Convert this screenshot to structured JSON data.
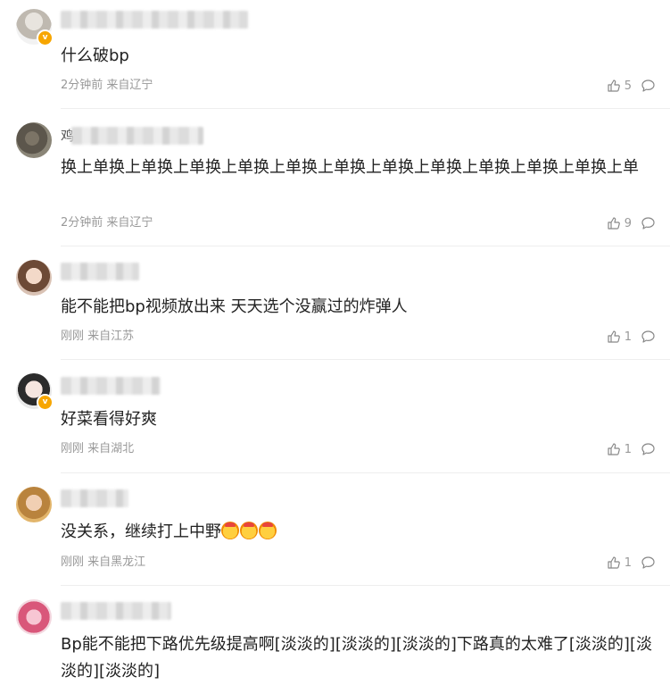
{
  "comments": [
    {
      "name_initial": "",
      "text": "什么破bp",
      "time": "2分钟前",
      "location": "来自辽宁",
      "likes": "5",
      "verified": true
    },
    {
      "name_initial": "鸡",
      "text": "换上单换上单换上单换上单换上单换上单换上单换上单换上单换上单换上单换上单",
      "time": "2分钟前",
      "location": "来自辽宁",
      "likes": "9",
      "verified": false
    },
    {
      "name_initial": "",
      "text": "能不能把bp视频放出来 天天选个没赢过的炸弹人",
      "time": "刚刚",
      "location": "来自江苏",
      "likes": "1",
      "verified": false
    },
    {
      "name_initial": "",
      "text": "好菜看得好爽",
      "time": "刚刚",
      "location": "来自湖北",
      "likes": "1",
      "verified": true
    },
    {
      "name_initial": "",
      "text": "没关系，继续打上中野",
      "time": "刚刚",
      "location": "来自黑龙江",
      "likes": "1",
      "verified": false
    },
    {
      "name_initial": "",
      "text": "Bp能不能把下路优先级提高啊[淡淡的][淡淡的][淡淡的]下路真的太难了[淡淡的][淡淡的][淡淡的]",
      "time": "",
      "location": "",
      "likes": "",
      "verified": false
    }
  ],
  "icons": {
    "like": "thumbs-up-icon",
    "reply": "comment-bubble-icon",
    "verified": "verified-badge-icon",
    "emoji": "blessing-emoji-icon"
  },
  "colors": {
    "verified": "#f7a600",
    "meta": "#999999",
    "text": "#222222",
    "divider": "#eeeeee"
  }
}
